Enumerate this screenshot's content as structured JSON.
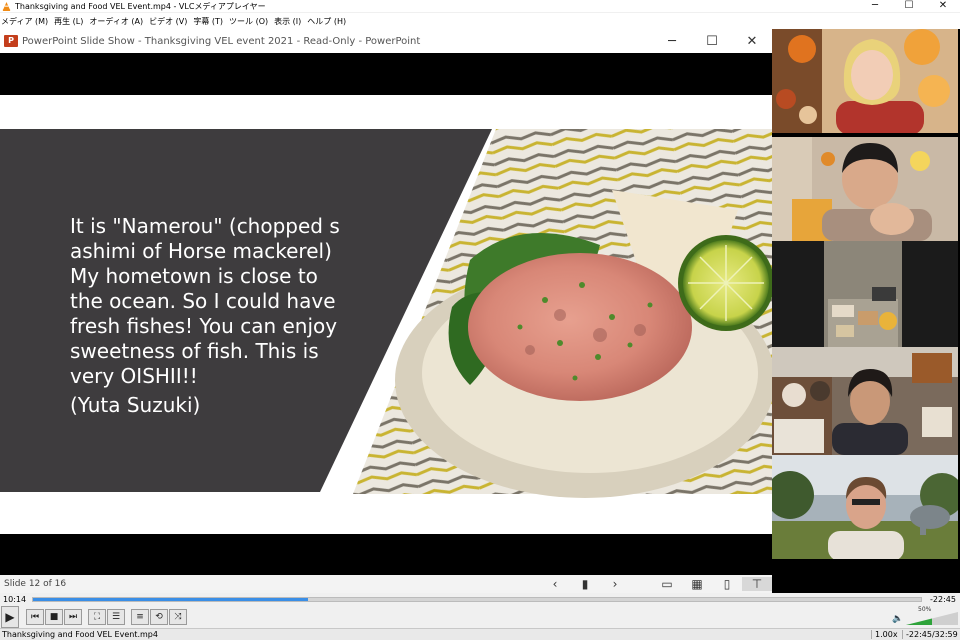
{
  "vlc": {
    "window_title": "Thanksgiving and Food VEL Event.mp4 - VLCメディアプレイヤー",
    "menu": [
      "メディア (M)",
      "再生 (L)",
      "オーディオ (A)",
      "ビデオ (V)",
      "字幕 (T)",
      "ツール (O)",
      "表示 (I)",
      "ヘルプ (H)"
    ],
    "current_time": "10:14",
    "remaining_time": "-22:45",
    "progress": 0.31,
    "volume_percent": "50%",
    "volume_level": 0.5,
    "status_file": "Thanksgiving and Food VEL Event.mp4",
    "status_speed": "1.00x",
    "status_time": "-22:45/32:59",
    "accent_color": "#3a8ee6"
  },
  "powerpoint": {
    "window_title": "PowerPoint Slide Show  -  Thanksgiving VEL event 2021  -  Read-Only  -  PowerPoint",
    "logo_letter": "P",
    "slide_counter": "Slide 12 of 16",
    "slide": {
      "lines": [
        "It is \"Namerou\" (chopped s",
        "ashimi of Horse mackerel)",
        "My hometown is close to",
        "the ocean. So I could have",
        "fresh fishes! You can enjoy",
        "sweetness of fish. This is",
        "very OISHII!!"
      ],
      "author": "(Yuta Suzuki)",
      "panel_color": "#3e3c3e"
    }
  },
  "participants": [
    {
      "id": "p1",
      "bg": "#d7b48a"
    },
    {
      "id": "p2",
      "bg": "#c9b9a6"
    },
    {
      "id": "p3",
      "bg": "#2a2a2a"
    },
    {
      "id": "p4",
      "bg": "#7a6a5c"
    },
    {
      "id": "p5",
      "bg": "#a7b2ba"
    }
  ]
}
